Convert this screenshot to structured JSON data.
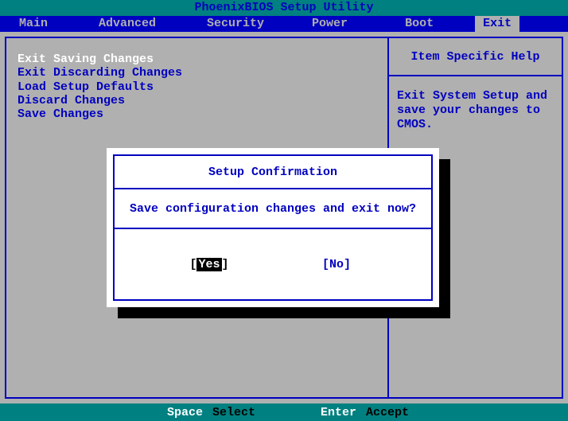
{
  "title": "PhoenixBIOS Setup Utility",
  "menu": {
    "items": [
      "Main",
      "Advanced",
      "Security",
      "Power",
      "Boot",
      "Exit"
    ],
    "active_index": 5
  },
  "exit_menu": {
    "items": [
      {
        "label": "Exit Saving Changes",
        "selected": true
      },
      {
        "label": "Exit Discarding Changes",
        "selected": false
      },
      {
        "label": "Load Setup Defaults",
        "selected": false
      },
      {
        "label": "Discard Changes",
        "selected": false
      },
      {
        "label": "Save Changes",
        "selected": false
      }
    ]
  },
  "help": {
    "title": "Item Specific Help",
    "text": "Exit System Setup and save your changes to CMOS."
  },
  "dialog": {
    "title": "Setup Confirmation",
    "message": "Save configuration changes and exit now?",
    "yes_label": "Yes",
    "no_label": "No",
    "selected": "yes"
  },
  "footer": {
    "key1": "Space",
    "action1": "Select",
    "key2": "Enter",
    "action2": "Accept"
  }
}
